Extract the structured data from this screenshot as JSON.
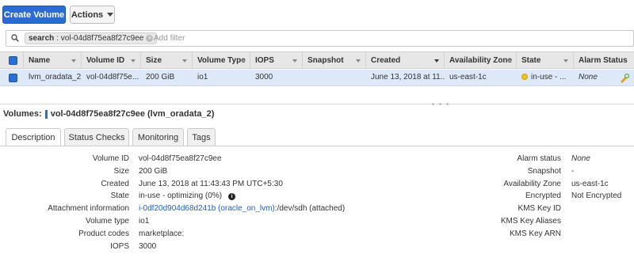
{
  "toolbar": {
    "create_label": "Create Volume",
    "actions_label": "Actions"
  },
  "search": {
    "chip_key": "search",
    "chip_value": ": vol-04d8f75ea8f27c9ee",
    "placeholder": "Add filter"
  },
  "table": {
    "headers": [
      "Name",
      "Volume ID",
      "Size",
      "Volume Type",
      "IOPS",
      "Snapshot",
      "Created",
      "Availability Zone",
      "State",
      "Alarm Status"
    ],
    "row": {
      "name": "lvm_oradata_2",
      "volume_id": "vol-04d8f75e...",
      "size": "200 GiB",
      "volume_type": "io1",
      "iops": "3000",
      "snapshot": "",
      "created": "June 13, 2018 at 11...",
      "az": "us-east-1c",
      "state": "in-use - ...",
      "alarm": "None"
    }
  },
  "detail": {
    "title_prefix": "Volumes:",
    "title_value": "vol-04d8f75ea8f27c9ee (lvm_oradata_2)",
    "tabs": [
      "Description",
      "Status Checks",
      "Monitoring",
      "Tags"
    ],
    "left": {
      "volume_id_label": "Volume ID",
      "volume_id": "vol-04d8f75ea8f27c9ee",
      "size_label": "Size",
      "size": "200 GiB",
      "created_label": "Created",
      "created": "June 13, 2018 at 11:43:43 PM UTC+5:30",
      "state_label": "State",
      "state": "in-use - optimizing (0%)",
      "attach_label": "Attachment information",
      "attach_link": "i-0df20d904d68d241b (oracle_on_lvm)",
      "attach_rest": ":/dev/sdh (attached)",
      "type_label": "Volume type",
      "type": "io1",
      "codes_label": "Product codes",
      "codes": "marketplace:",
      "iops_label": "IOPS",
      "iops": "3000"
    },
    "right": {
      "alarm_label": "Alarm status",
      "alarm": "None",
      "snapshot_label": "Snapshot",
      "snapshot": "-",
      "az_label": "Availability Zone",
      "az": "us-east-1c",
      "encrypted_label": "Encrypted",
      "encrypted": "Not Encrypted",
      "kms_id_label": "KMS Key ID",
      "kms_alias_label": "KMS Key Aliases",
      "kms_arn_label": "KMS Key ARN"
    }
  },
  "colors": {
    "accent": "#2b6bd6",
    "row_selected": "#dde9f8",
    "link": "#1f5fbf",
    "state_dot": "#f0c419"
  }
}
